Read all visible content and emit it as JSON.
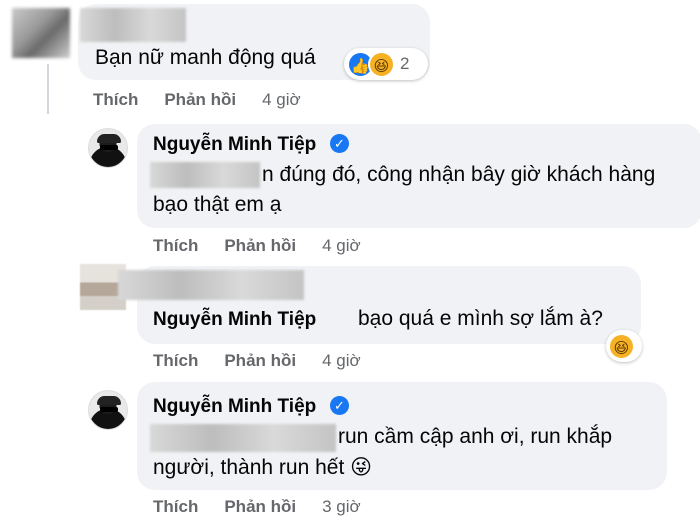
{
  "comments": [
    {
      "author": "",
      "text": "Bạn nữ manh động quá",
      "reactions": {
        "icons": [
          "like-icon",
          "haha-icon"
        ],
        "count": "2"
      },
      "actions": {
        "like": "Thích",
        "reply": "Phản hồi",
        "time": "4 giờ"
      }
    },
    {
      "author": "Nguyễn Minh Tiệp",
      "text_line1": "n đúng đó, công nhận bây giờ khách hàng",
      "text_line2": "bạo thật em ạ",
      "actions": {
        "like": "Thích",
        "reply": "Phản hồi",
        "time": "4 giờ"
      }
    },
    {
      "author": "",
      "tag": "Nguyễn Minh Tiệp",
      "text": "bạo quá e mình sợ lắm à?",
      "reaction_icon": "haha-icon",
      "actions": {
        "like": "Thích",
        "reply": "Phản hồi",
        "time": "4 giờ"
      }
    },
    {
      "author": "Nguyễn Minh Tiệp",
      "text_line1": "run cầm cập anh ơi, run khắp",
      "text_line2": "người, thành run hết 😜",
      "actions": {
        "like": "Thích",
        "reply": "Phản hồi",
        "time": "3 giờ"
      }
    }
  ],
  "colors": {
    "bubble": "#f0f2f5",
    "meta": "#65676b",
    "verified": "#1877f2"
  }
}
